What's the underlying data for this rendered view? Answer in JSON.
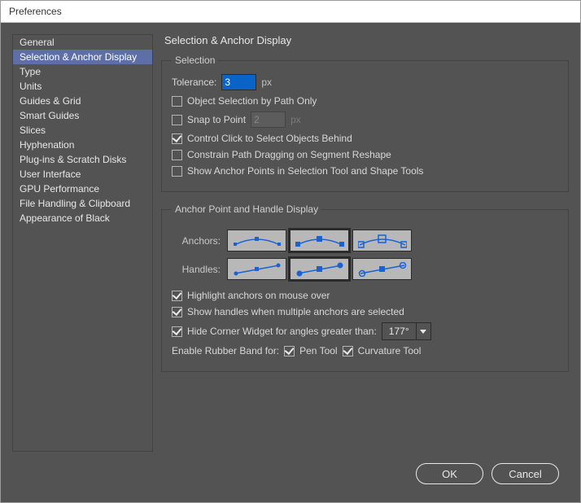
{
  "window": {
    "title": "Preferences"
  },
  "sidebar": {
    "items": [
      {
        "label": "General"
      },
      {
        "label": "Selection & Anchor Display"
      },
      {
        "label": "Type"
      },
      {
        "label": "Units"
      },
      {
        "label": "Guides & Grid"
      },
      {
        "label": "Smart Guides"
      },
      {
        "label": "Slices"
      },
      {
        "label": "Hyphenation"
      },
      {
        "label": "Plug-ins & Scratch Disks"
      },
      {
        "label": "User Interface"
      },
      {
        "label": "GPU Performance"
      },
      {
        "label": "File Handling & Clipboard"
      },
      {
        "label": "Appearance of Black"
      }
    ],
    "selected_index": 1
  },
  "page": {
    "title": "Selection & Anchor Display",
    "selection": {
      "legend": "Selection",
      "tolerance_label": "Tolerance:",
      "tolerance_value": "3",
      "tolerance_unit": "px",
      "object_selection_label": "Object Selection by Path Only",
      "object_selection_checked": false,
      "snap_to_point_label": "Snap to Point",
      "snap_to_point_checked": false,
      "snap_to_point_value": "2",
      "snap_to_point_unit": "px",
      "ctrl_click_label": "Control Click to Select Objects Behind",
      "ctrl_click_checked": true,
      "constrain_label": "Constrain Path Dragging on Segment Reshape",
      "constrain_checked": false,
      "show_anchors_selection_label": "Show Anchor Points in Selection Tool and Shape Tools",
      "show_anchors_selection_checked": false
    },
    "anchor": {
      "legend": "Anchor Point and Handle Display",
      "anchors_label": "Anchors:",
      "anchors_selected": 1,
      "handles_label": "Handles:",
      "handles_selected": 1,
      "highlight_label": "Highlight anchors on mouse over",
      "highlight_checked": true,
      "show_handles_label": "Show handles when multiple anchors are selected",
      "show_handles_checked": true,
      "hide_corner_label": "Hide Corner Widget for angles greater than:",
      "hide_corner_checked": true,
      "hide_corner_value": "177°",
      "rubber_band_label": "Enable Rubber Band for:",
      "pen_tool_label": "Pen Tool",
      "pen_tool_checked": true,
      "curvature_label": "Curvature Tool",
      "curvature_checked": true
    }
  },
  "footer": {
    "ok": "OK",
    "cancel": "Cancel"
  }
}
